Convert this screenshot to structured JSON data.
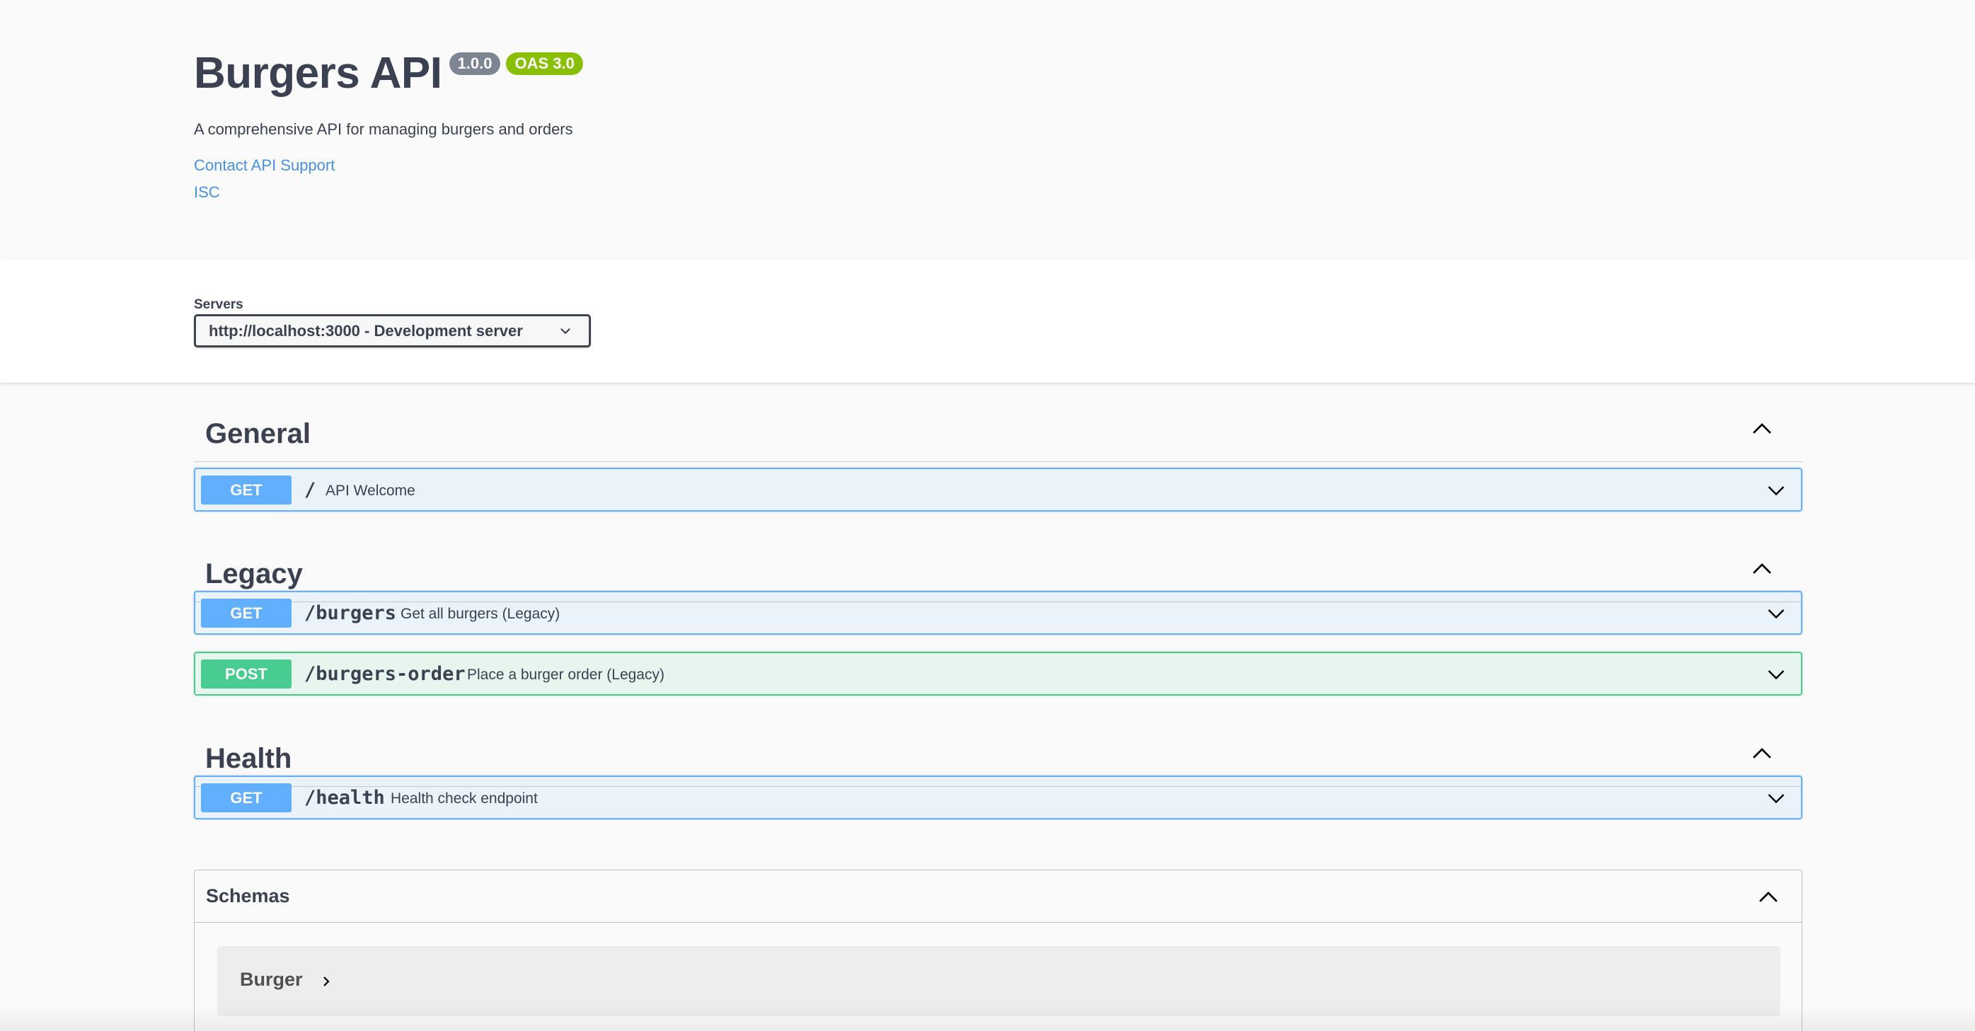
{
  "info": {
    "title": "Burgers API",
    "version_badge": "1.0.0",
    "oas_badge": "OAS 3.0",
    "description": "A comprehensive API for managing burgers and orders",
    "contact_link": "Contact API Support",
    "license_link": "ISC"
  },
  "servers": {
    "label": "Servers",
    "selected": "http://localhost:3000 - Development server"
  },
  "tags": [
    {
      "name": "General",
      "operations": [
        {
          "method": "GET",
          "path": "/",
          "summary": "API Welcome"
        }
      ]
    },
    {
      "name": "Legacy",
      "operations": [
        {
          "method": "GET",
          "path": "/burgers",
          "summary": "Get all burgers (Legacy)"
        },
        {
          "method": "POST",
          "path": "/burgers-order",
          "summary": "Place a burger order (Legacy)"
        }
      ]
    },
    {
      "name": "Health",
      "operations": [
        {
          "method": "GET",
          "path": "/health",
          "summary": "Health check endpoint"
        }
      ]
    }
  ],
  "schemas": {
    "title": "Schemas",
    "models": [
      "Burger"
    ]
  },
  "colors": {
    "get": "#61affe",
    "post": "#49cc90",
    "link": "#4990e2",
    "version_badge": "#7d8492",
    "oas_badge": "#89bf04"
  },
  "icons": {
    "tag_toggle": "chevron-up-icon",
    "operation_toggle": "chevron-down-icon",
    "model_expand": "chevron-right-icon"
  }
}
